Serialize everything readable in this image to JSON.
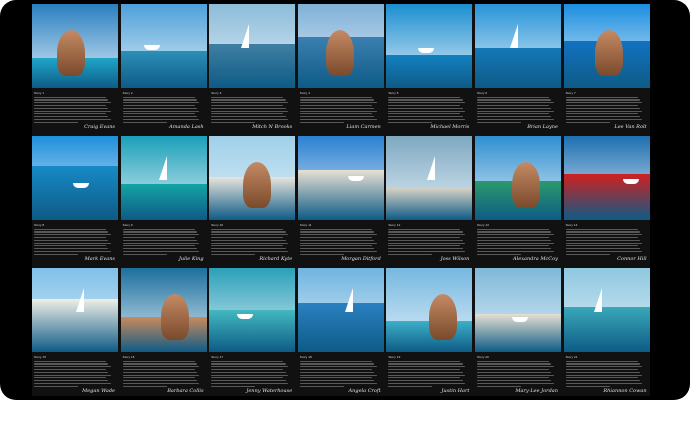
{
  "colors": {
    "frame": "#000000",
    "text": "#dddddd",
    "caption": "#e6e6e6"
  },
  "tiles": [
    {
      "story": "Story 1",
      "signature": "Craig Evans",
      "photo": "man-on-beach-lounger",
      "sky": "#2a7fc0",
      "sea": "#1fa6c9"
    },
    {
      "story": "Story 2",
      "signature": "Amanda Lash",
      "photo": "group-on-deck",
      "sky": "#4da0d8",
      "sea": "#2c8fb8"
    },
    {
      "story": "Story 3",
      "signature": "Mitch N Brooks",
      "photo": "man-in-blue-shirt",
      "sky": "#8cbcd8",
      "sea": "#3f7fa3"
    },
    {
      "story": "Story 4",
      "signature": "Liam Carmen",
      "photo": "marina-collage",
      "sky": "#7fb0d8",
      "sea": "#3b7fb0"
    },
    {
      "story": "Story 5",
      "signature": "Michael Morris",
      "photo": "speedboat",
      "sky": "#1b8ed0",
      "sea": "#1380c0"
    },
    {
      "story": "Story 6",
      "signature": "Brian Layne",
      "photo": "couple-on-boat",
      "sky": "#2894d8",
      "sea": "#1478b8"
    },
    {
      "story": "Story 7",
      "signature": "Lee Van Rolt",
      "photo": "sailing-yacht",
      "sky": "#1b8ee0",
      "sea": "#1272c0"
    },
    {
      "story": "Story 8",
      "signature": "Mark Evans",
      "photo": "skydiver-over-yacht",
      "sky": "#1e8fdb",
      "sea": "#178ac6"
    },
    {
      "story": "Story 9",
      "signature": "Julie King",
      "photo": "swimmer",
      "sky": "#1aa0b8",
      "sea": "#13a4a4"
    },
    {
      "story": "Story 10",
      "signature": "Richard Kyte",
      "photo": "woman-on-beach",
      "sky": "#9fd0e8",
      "sea": "#e8e4dc"
    },
    {
      "story": "Story 11",
      "signature": "Morgan Ditford",
      "photo": "man-on-sand",
      "sky": "#2b80d0",
      "sea": "#e7e0d4"
    },
    {
      "story": "Story 12",
      "signature": "Joss Wilson",
      "photo": "hands-and-man",
      "sky": "#7fa8c0",
      "sea": "#d8d2c6"
    },
    {
      "story": "Story 13",
      "signature": "Alexandra McCoy",
      "photo": "speedboat-resort",
      "sky": "#2f8fd0",
      "sea": "#2b9a6a"
    },
    {
      "story": "Story 14",
      "signature": "Connor Hill",
      "photo": "couple-at-sea",
      "sky": "#1e6fb0",
      "sea": "#d02020"
    },
    {
      "story": "Story 15",
      "signature": "Megan Wade",
      "photo": "woman-smiling",
      "sky": "#7fc0e8",
      "sea": "#f0efe8"
    },
    {
      "story": "Story 16",
      "signature": "Barbara Collis",
      "photo": "woman-sunglasses",
      "sky": "#1c6f9c",
      "sea": "#c98b5c"
    },
    {
      "story": "Story 17",
      "signature": "Jenny Waterhouse",
      "photo": "reef-aerial",
      "sky": "#2aa0b8",
      "sea": "#43b8c0"
    },
    {
      "story": "Story 18",
      "signature": "Angela Croft",
      "photo": "yacht-at-sea",
      "sky": "#6fb4e0",
      "sea": "#2a80c0"
    },
    {
      "story": "Story 19",
      "signature": "Justin Hart",
      "photo": "catamaran",
      "sky": "#76b8e0",
      "sea": "#3db0c8"
    },
    {
      "story": "Story 20",
      "signature": "Mary-Lee Jordan",
      "photo": "man-on-sand",
      "sky": "#7fb8d8",
      "sea": "#e5dfd2"
    },
    {
      "story": "Story 21",
      "signature": "Rhiannon Cowan",
      "photo": "woman-on-beach",
      "sky": "#8fc8e0",
      "sea": "#3aa8b8"
    }
  ]
}
